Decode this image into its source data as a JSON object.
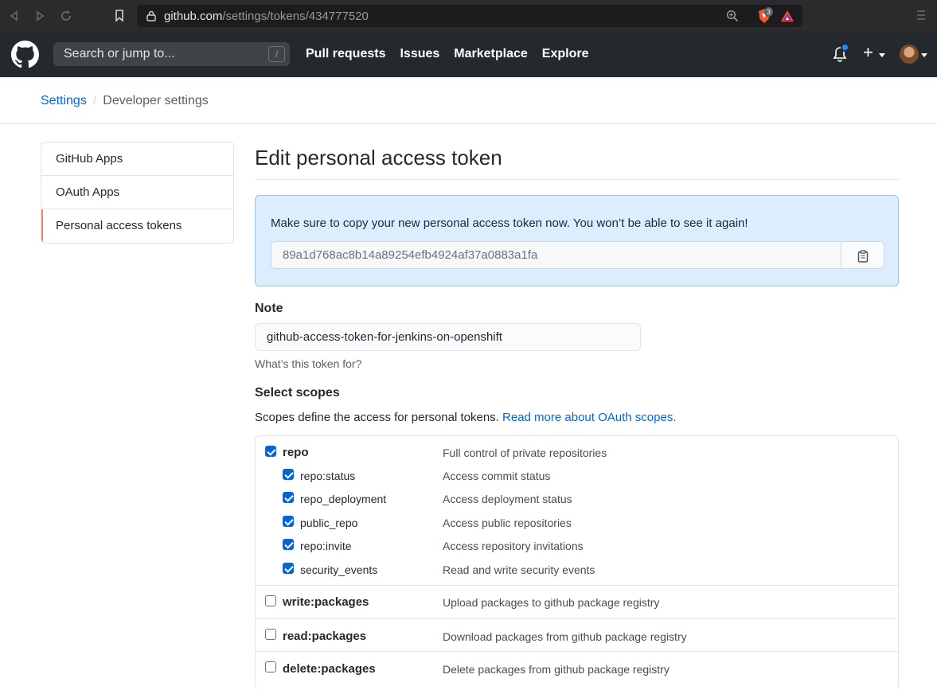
{
  "browser": {
    "url_host": "github.com",
    "url_path": "/settings/tokens/434777520",
    "shields_count": "3"
  },
  "header": {
    "search_placeholder": "Search or jump to...",
    "search_shortcut": "/",
    "nav": [
      "Pull requests",
      "Issues",
      "Marketplace",
      "Explore"
    ],
    "plus": "+"
  },
  "breadcrumb": {
    "settings": "Settings",
    "separator": "/",
    "current": "Developer settings"
  },
  "sidebar": {
    "items": [
      {
        "label": "GitHub Apps"
      },
      {
        "label": "OAuth Apps"
      },
      {
        "label": "Personal access tokens"
      }
    ]
  },
  "main": {
    "title": "Edit personal access token",
    "flash_message": "Make sure to copy your new personal access token now. You won’t be able to see it again!",
    "token": "89a1d768ac8b14a89254efb4924af37a0883a1fa",
    "note_label": "Note",
    "note_value": "github-access-token-for-jenkins-on-openshift",
    "note_hint": "What’s this token for?",
    "scopes_label": "Select scopes",
    "scopes_desc": "Scopes define the access for personal tokens.",
    "scopes_link": "Read more about OAuth scopes."
  },
  "scopes": [
    {
      "name": "repo",
      "desc": "Full control of private repositories",
      "checked": true,
      "children": [
        {
          "name": "repo:status",
          "desc": "Access commit status",
          "checked": true
        },
        {
          "name": "repo_deployment",
          "desc": "Access deployment status",
          "checked": true
        },
        {
          "name": "public_repo",
          "desc": "Access public repositories",
          "checked": true
        },
        {
          "name": "repo:invite",
          "desc": "Access repository invitations",
          "checked": true
        },
        {
          "name": "security_events",
          "desc": "Read and write security events",
          "checked": true
        }
      ]
    },
    {
      "name": "write:packages",
      "desc": "Upload packages to github package registry",
      "checked": false
    },
    {
      "name": "read:packages",
      "desc": "Download packages from github package registry",
      "checked": false
    },
    {
      "name": "delete:packages",
      "desc": "Delete packages from github package registry",
      "checked": false
    }
  ],
  "colors": {
    "header_bg": "#24292e",
    "link": "#0366d6",
    "flash_bg": "#dbedff",
    "active_marker": "#f9826c"
  }
}
